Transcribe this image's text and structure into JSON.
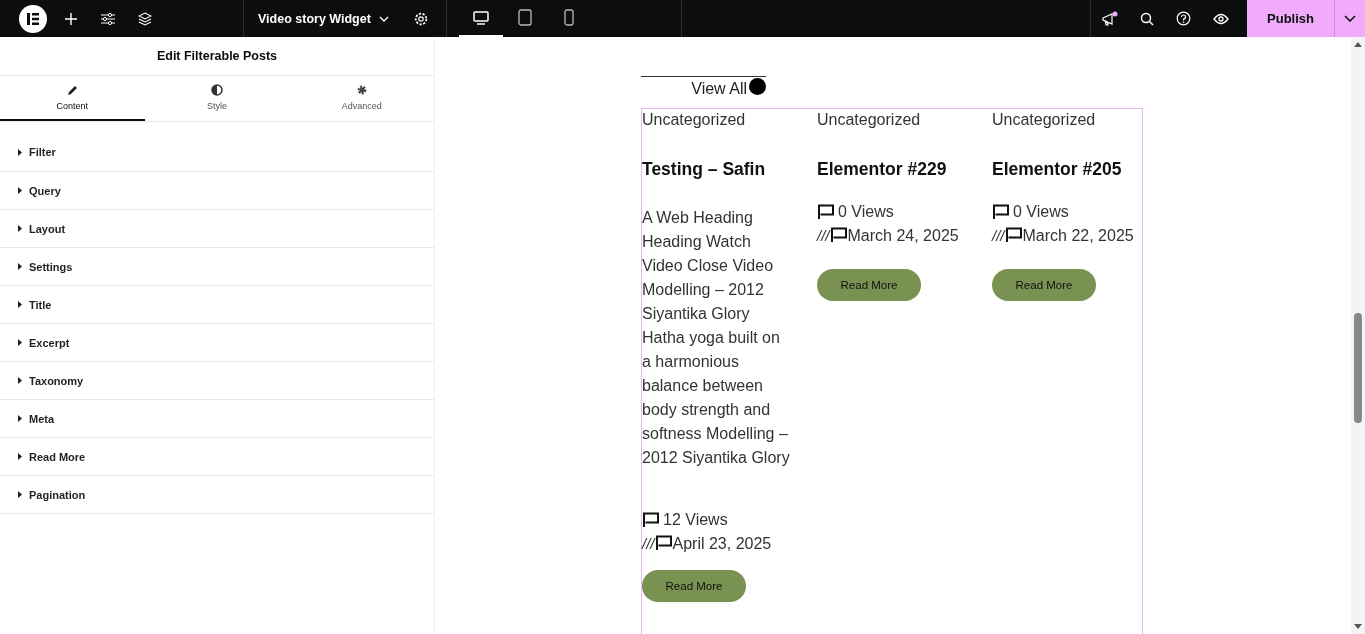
{
  "topbar": {
    "page_title": "Video story Widget",
    "devices": [
      {
        "kind": "desktop",
        "selected": true
      },
      {
        "kind": "tablet",
        "selected": false
      },
      {
        "kind": "mobile",
        "selected": false
      }
    ],
    "notification": true,
    "publish": "Publish"
  },
  "panel": {
    "title": "Edit Filterable Posts",
    "tabs": [
      {
        "kind": "content",
        "label": "Content",
        "selected": true
      },
      {
        "kind": "style",
        "label": "Style",
        "selected": false
      },
      {
        "kind": "advanced",
        "label": "Advanced",
        "selected": false
      }
    ],
    "sections": [
      {
        "label": "Filter",
        "expanded": false
      },
      {
        "label": "Query",
        "expanded": false
      },
      {
        "label": "Layout",
        "expanded": false
      },
      {
        "label": "Settings",
        "expanded": false
      },
      {
        "label": "Title",
        "expanded": false
      },
      {
        "label": "Excerpt",
        "expanded": false
      },
      {
        "label": "Taxonomy",
        "expanded": false
      },
      {
        "label": "Meta",
        "expanded": false
      },
      {
        "label": "Read More",
        "expanded": false
      },
      {
        "label": "Pagination",
        "expanded": false
      }
    ]
  },
  "canvas": {
    "view_all": "View All",
    "posts": [
      {
        "category": "Uncategorized",
        "title": "Testing – Safin",
        "excerpt": "A Web Heading Heading Watch Video Close Video Modelling – 2012 Siyantika Glory Hatha yoga built on a harmonious balance between body strength and softness Modelling – 2012 Siyantika Glory",
        "views": "12 Views",
        "separator": "///",
        "date": "April 23, 2025",
        "button": "Read More"
      },
      {
        "category": "Uncategorized",
        "title": "Elementor #229",
        "views": "0 Views",
        "separator": "///",
        "date": "March 24, 2025",
        "button": "Read More"
      },
      {
        "category": "Uncategorized",
        "title": "Elementor #205",
        "views": "0 Views",
        "separator": "///",
        "date": "March 22, 2025",
        "button": "Read More"
      }
    ]
  }
}
